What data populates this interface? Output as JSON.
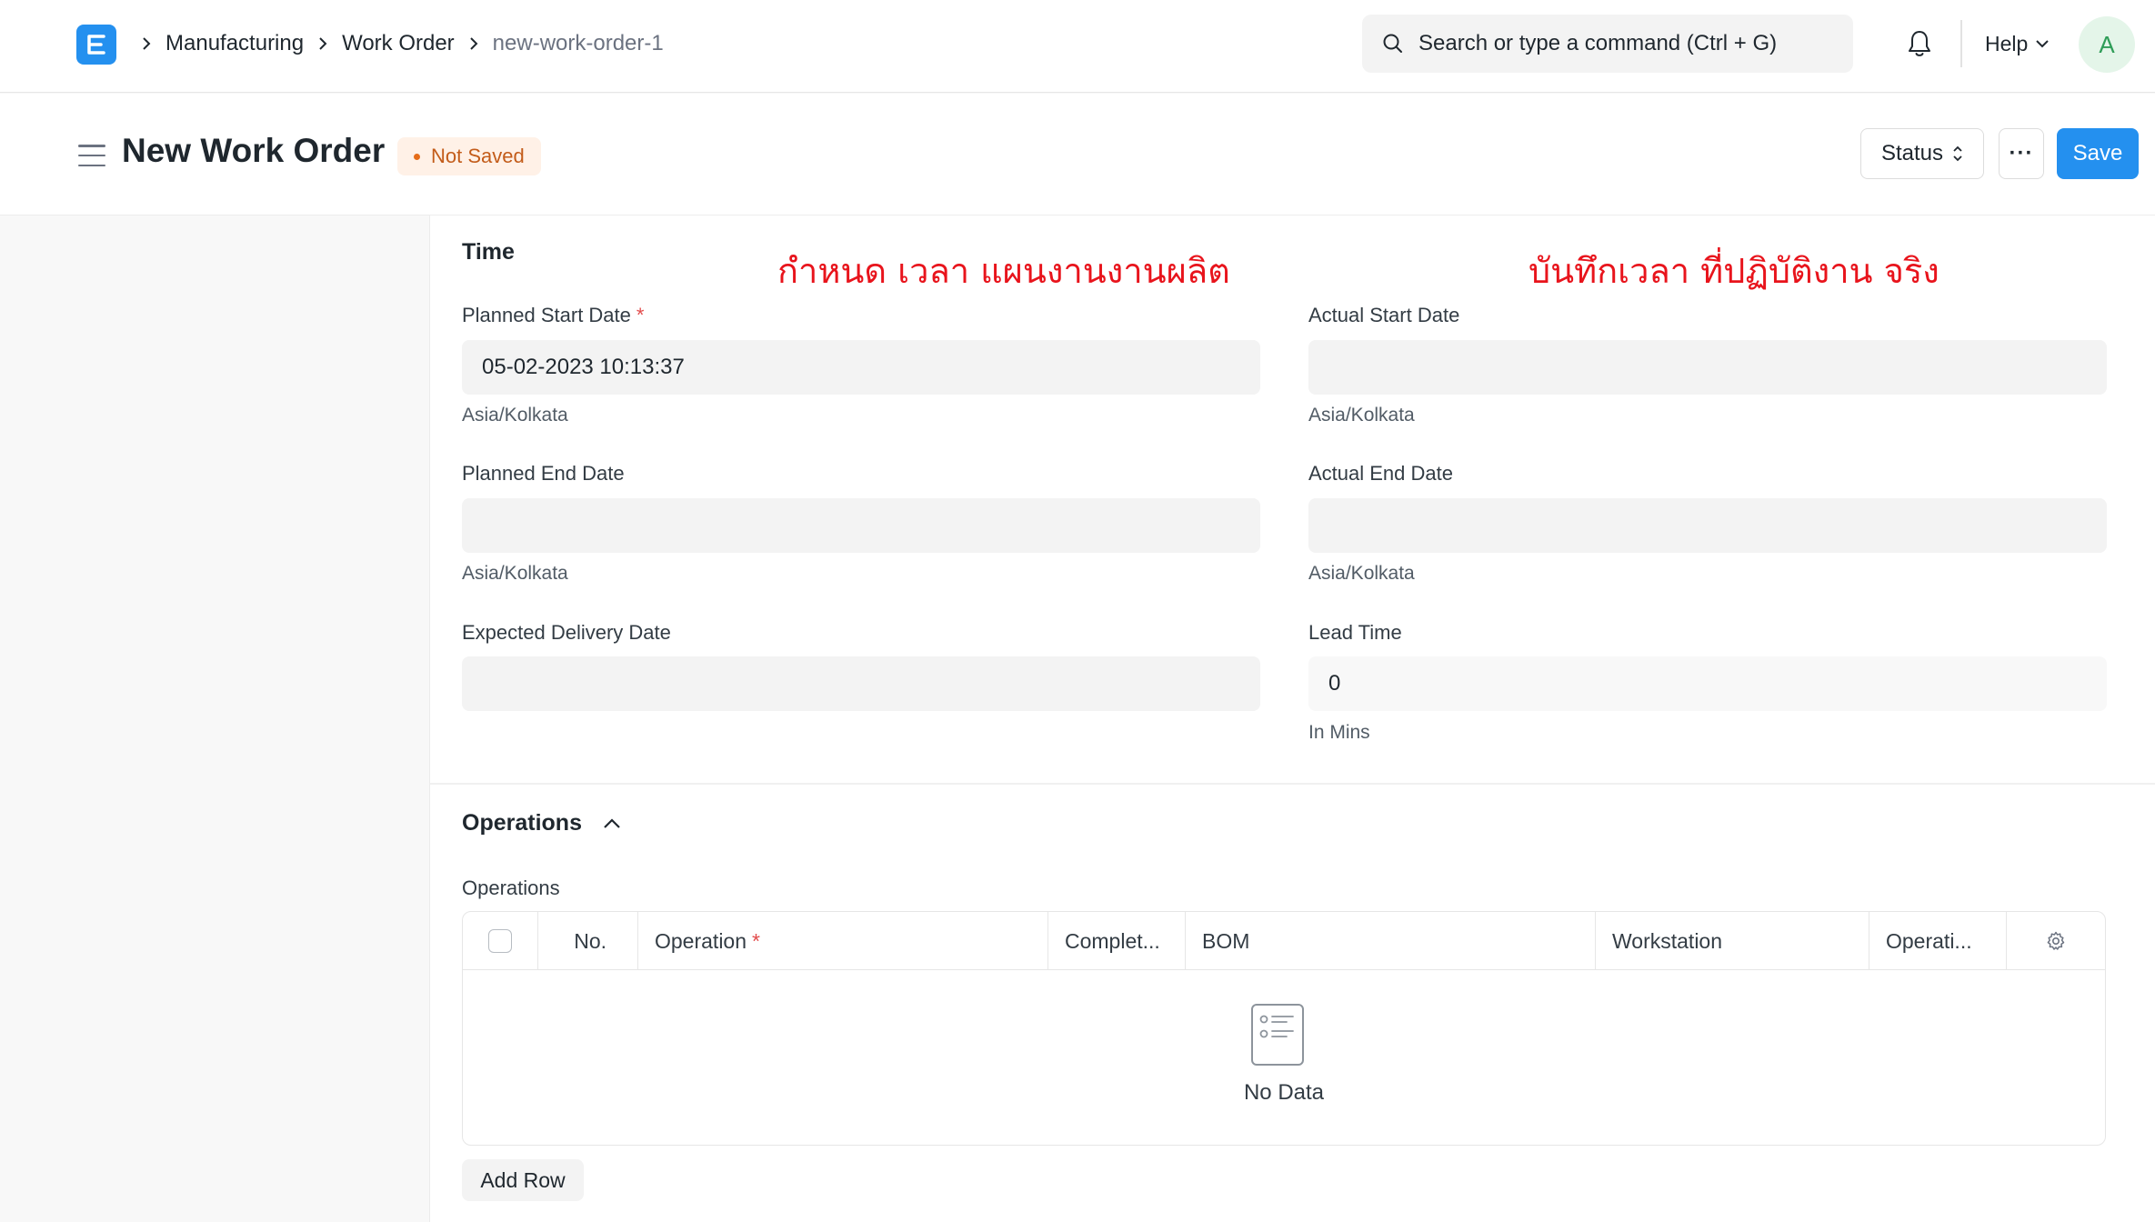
{
  "navbar": {
    "breadcrumbs": [
      "Manufacturing",
      "Work Order",
      "new-work-order-1"
    ],
    "search_placeholder": "Search or type a command (Ctrl + G)",
    "help_label": "Help",
    "avatar_initial": "A"
  },
  "header": {
    "title": "New Work Order",
    "status_indicator": "Not Saved",
    "status_button": "Status",
    "more_button": "···",
    "save_button": "Save"
  },
  "time_section": {
    "title": "Time",
    "annotation_left": "กำหนด เวลา แผนงานงานผลิต",
    "annotation_right": "บันทึกเวลา ที่ปฏิบัติงาน จริง",
    "planned_start_label": "Planned Start Date",
    "planned_start_value": "05-02-2023 10:13:37",
    "planned_start_tz": "Asia/Kolkata",
    "planned_end_label": "Planned End Date",
    "planned_end_value": "",
    "planned_end_tz": "Asia/Kolkata",
    "expected_delivery_label": "Expected Delivery Date",
    "expected_delivery_value": "",
    "actual_start_label": "Actual Start Date",
    "actual_start_value": "",
    "actual_start_tz": "Asia/Kolkata",
    "actual_end_label": "Actual End Date",
    "actual_end_value": "",
    "actual_end_tz": "Asia/Kolkata",
    "lead_time_label": "Lead Time",
    "lead_time_value": "0",
    "lead_time_unit": "In Mins"
  },
  "operations_section": {
    "title": "Operations",
    "table_label": "Operations",
    "columns": [
      "No.",
      "Operation",
      "Complet...",
      "BOM",
      "Workstation",
      "Operati..."
    ],
    "empty_text": "No Data",
    "add_row_button": "Add Row"
  },
  "colors": {
    "primary": "#2490ef",
    "annotation": "#e8141c",
    "not_saved_bg": "#fff1e7",
    "not_saved_text": "#c35c1a"
  }
}
